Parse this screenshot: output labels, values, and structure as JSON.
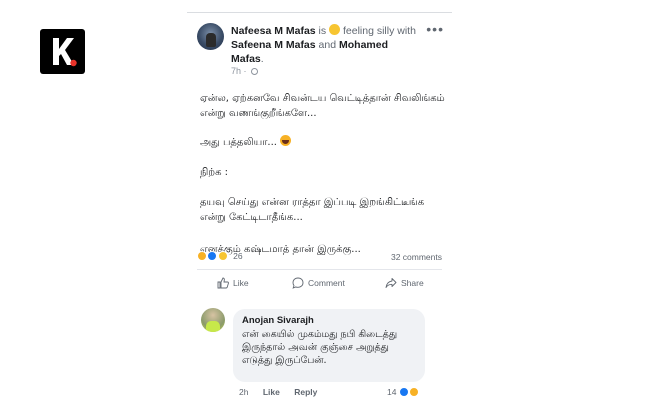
{
  "watermark": {
    "logo_text": "K."
  },
  "post": {
    "author": "Nafeesa M Mafas",
    "is_text": "is",
    "feeling": "feeling silly",
    "with_text": "with",
    "tag1": "Safeena M Mafas",
    "and_text": "and",
    "tag2": "Mohamed Mafas",
    "time": "7h ·",
    "more_icon": "more-icon",
    "paragraphs": [
      "ஏன்ல, ஏற்கனவே சிவன்டய வெட்டித்தான் சிவலிங்கம் என்று வணங்குறீங்களே...",
      "அது பத்தலியா...",
      "நிற்க :",
      "தயவு செய்து என்ன ராத்தா இப்படி இறங்கிட்டீங்க என்று கேட்டிடாதீங்க...",
      "எனக்கும் கஷ்டமாத் தான் இருக்கு..."
    ],
    "reaction_count": "26",
    "comments_count": "32 comments",
    "actions": {
      "like": "Like",
      "comment": "Comment",
      "share": "Share"
    }
  },
  "comment": {
    "author": "Anojan Sivarajh",
    "text": "என் கையில் முகம்மது நபி கிடைத்து இருந்தால் அவன் குஞ்சை அறுத்து எடுத்து இருப்பேன்.",
    "time": "2h",
    "like": "Like",
    "reply": "Reply",
    "reaction_count": "14"
  },
  "colors": {
    "accent": "#1877f2",
    "text": "#1c1e21",
    "muted": "#606770"
  }
}
